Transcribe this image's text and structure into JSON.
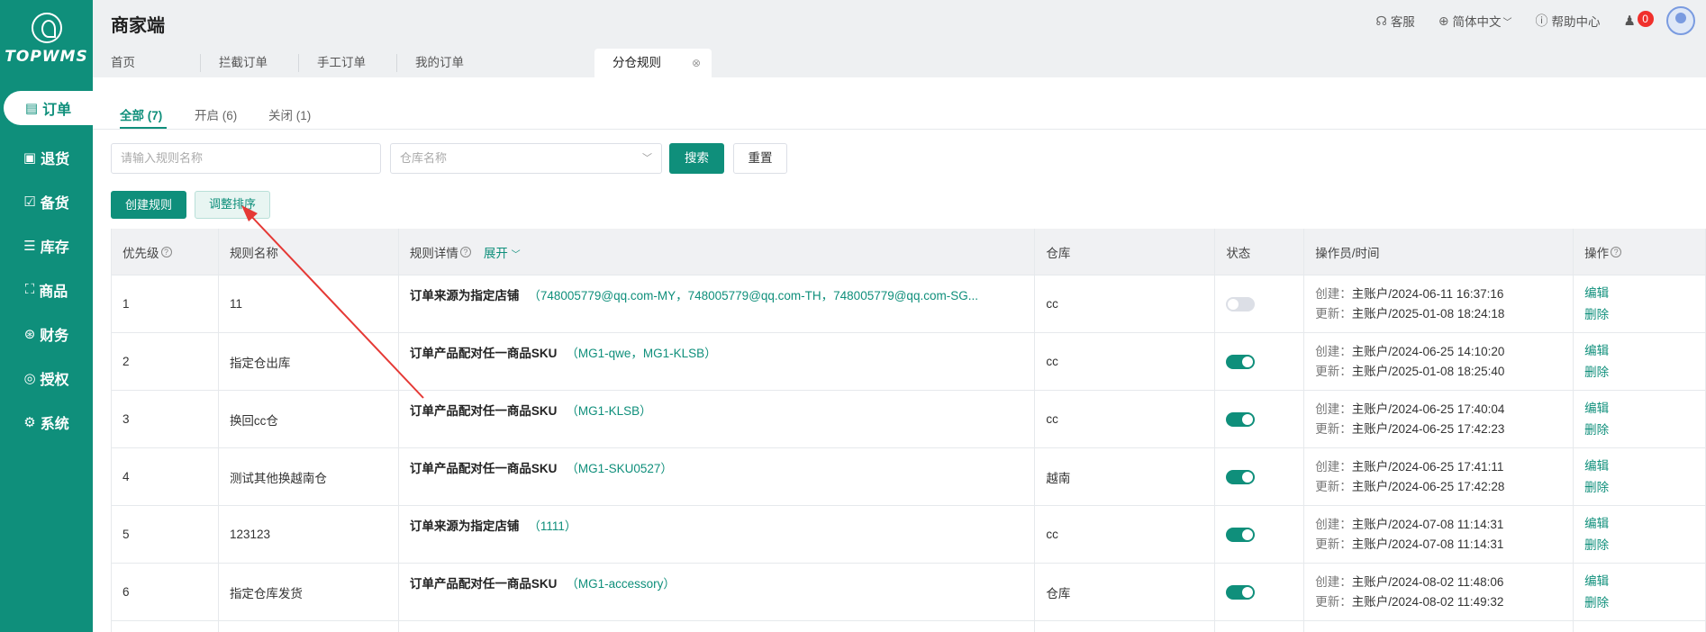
{
  "sidebar": {
    "logo_text": "TOPWMS",
    "items": [
      {
        "label": "订单",
        "icon": "order-icon",
        "glyph": "▤"
      },
      {
        "label": "退货",
        "icon": "return-icon",
        "glyph": "▣"
      },
      {
        "label": "备货",
        "icon": "stock-up-icon",
        "glyph": "☑"
      },
      {
        "label": "库存",
        "icon": "inventory-icon",
        "glyph": "☰"
      },
      {
        "label": "商品",
        "icon": "product-icon",
        "glyph": "⛶"
      },
      {
        "label": "财务",
        "icon": "finance-icon",
        "glyph": "⊛"
      },
      {
        "label": "授权",
        "icon": "auth-icon",
        "glyph": "◎"
      },
      {
        "label": "系统",
        "icon": "system-icon",
        "glyph": "⚙"
      }
    ]
  },
  "header": {
    "title": "商家端",
    "service": "客服",
    "language": "简体中文",
    "help": "帮助中心",
    "notification_count": "0"
  },
  "tabs": [
    "首页",
    "拦截订单",
    "手工订单",
    "我的订单",
    "分仓规则"
  ],
  "subtabs": [
    "全部 (7)",
    "开启 (6)",
    "关闭 (1)"
  ],
  "filters": {
    "rule_name_placeholder": "请输入规则名称",
    "warehouse_placeholder": "仓库名称",
    "search": "搜索",
    "reset": "重置"
  },
  "actions": {
    "create": "创建规则",
    "sort": "调整排序"
  },
  "table": {
    "headers": {
      "priority": "优先级",
      "name": "规则名称",
      "detail": "规则详情",
      "expand": "展开",
      "warehouse": "仓库",
      "status": "状态",
      "operator": "操作员/时间",
      "actions": "操作"
    },
    "created_label": "创建：",
    "updated_label": "更新：",
    "edit": "编辑",
    "delete": "删除",
    "rows": [
      {
        "priority": "1",
        "name": "11",
        "type": "订单来源为指定店铺",
        "value": "（748005779@qq.com-MY，748005779@qq.com-TH，748005779@qq.com-SG...",
        "warehouse": "cc",
        "enabled": false,
        "created": "主账户/2024-06-11 16:37:16",
        "updated": "主账户/2025-01-08 18:24:18"
      },
      {
        "priority": "2",
        "name": "指定仓出库",
        "type": "订单产品配对任一商品SKU",
        "value": "（MG1-qwe，MG1-KLSB）",
        "warehouse": "cc",
        "enabled": true,
        "created": "主账户/2024-06-25 14:10:20",
        "updated": "主账户/2025-01-08 18:25:40"
      },
      {
        "priority": "3",
        "name": "换回cc仓",
        "type": "订单产品配对任一商品SKU",
        "value": "（MG1-KLSB）",
        "warehouse": "cc",
        "enabled": true,
        "created": "主账户/2024-06-25 17:40:04",
        "updated": "主账户/2024-06-25 17:42:23"
      },
      {
        "priority": "4",
        "name": "测试其他换越南仓",
        "type": "订单产品配对任一商品SKU",
        "value": "（MG1-SKU0527）",
        "warehouse": "越南",
        "enabled": true,
        "created": "主账户/2024-06-25 17:41:11",
        "updated": "主账户/2024-06-25 17:42:28"
      },
      {
        "priority": "5",
        "name": "123123",
        "type": "订单来源为指定店铺",
        "value": "（1111）",
        "warehouse": "cc",
        "enabled": true,
        "created": "主账户/2024-07-08 11:14:31",
        "updated": "主账户/2024-07-08 11:14:31"
      },
      {
        "priority": "6",
        "name": "指定仓库发货",
        "type": "订单产品配对任一商品SKU",
        "value": "（MG1-accessory）",
        "warehouse": "仓库",
        "enabled": true,
        "created": "主账户/2024-08-02 11:48:06",
        "updated": "主账户/2024-08-02 11:49:32"
      }
    ]
  },
  "colors": {
    "primary": "#0f8f7b",
    "annotation": "#e53935"
  }
}
